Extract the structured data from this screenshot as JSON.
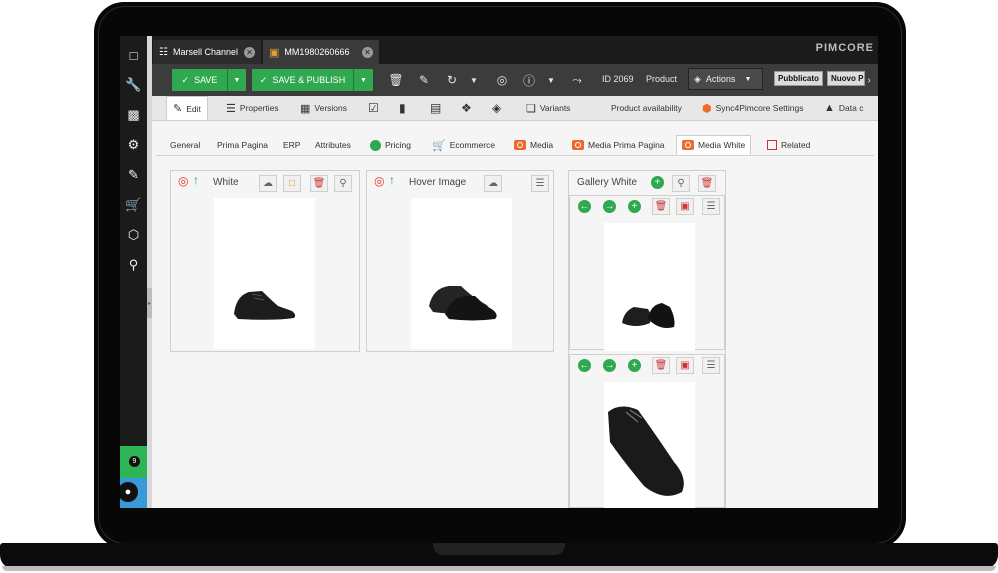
{
  "window_tabs": [
    {
      "label": "Marsell Channel",
      "icon": "tree-icon"
    },
    {
      "label": "MM1980260666",
      "icon": "cube-icon"
    }
  ],
  "brand": "PIMCORE",
  "toolbar": {
    "save_label": "SAVE",
    "save_publish_label": "SAVE & PUBLISH",
    "id_text": "ID 2069",
    "class_text": "Product",
    "actions_label": "Actions",
    "status_published": "Pubblicato",
    "status_new": "Nuovo P"
  },
  "subtabs": [
    {
      "label": "Edit",
      "icon": "pencil-icon"
    },
    {
      "label": "Properties",
      "icon": "sliders-icon"
    },
    {
      "label": "Versions",
      "icon": "versions-icon"
    },
    {
      "label": "",
      "icon": "calendar-check-icon"
    },
    {
      "label": "",
      "icon": "bookmark-icon"
    },
    {
      "label": "",
      "icon": "notes-icon"
    },
    {
      "label": "",
      "icon": "tag-icon"
    },
    {
      "label": "",
      "icon": "target-icon"
    },
    {
      "label": "Variants",
      "icon": "variants-icon"
    },
    {
      "label": "Product availability",
      "icon": ""
    },
    {
      "label": "Sync4Pimcore Settings",
      "icon": "sync-icon"
    },
    {
      "label": "Data c",
      "icon": "bell-icon"
    }
  ],
  "content_tabs": [
    {
      "label": "General"
    },
    {
      "label": "Prima Pagina"
    },
    {
      "label": "ERP"
    },
    {
      "label": "Attributes"
    },
    {
      "label": "Pricing"
    },
    {
      "label": "Ecommerce"
    },
    {
      "label": "Media"
    },
    {
      "label": "Media Prima Pagina"
    },
    {
      "label": "Media White"
    },
    {
      "label": "Related"
    }
  ],
  "panels": {
    "white_title": "White",
    "hover_title": "Hover Image",
    "gallery_title": "Gallery White"
  },
  "sidebar_badge": "9",
  "colors": {
    "accent_green": "#2fa84f",
    "media_orange": "#ee6a2b",
    "dark_bg": "#1b1b1b"
  }
}
